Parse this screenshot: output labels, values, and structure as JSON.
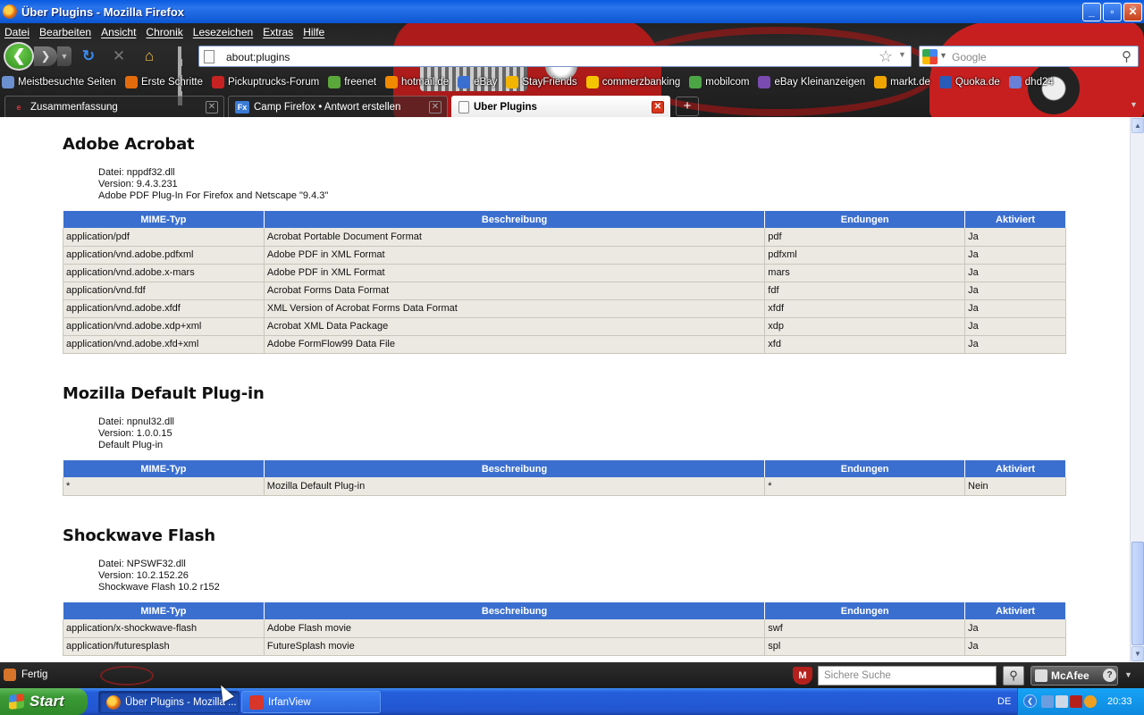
{
  "window": {
    "title": "Über Plugins - Mozilla Firefox",
    "controls": {
      "minimize": "_",
      "maximize": "▫",
      "close": "✕"
    }
  },
  "menu": [
    "Datei",
    "Bearbeiten",
    "Ansicht",
    "Chronik",
    "Lesezeichen",
    "Extras",
    "Hilfe"
  ],
  "navbar": {
    "url": "about:plugins",
    "search_placeholder": "Google",
    "icons": [
      "back-arrow-icon",
      "forward-arrow-icon",
      "reload-icon",
      "stop-icon",
      "home-icon",
      "sidebar-bars-icon",
      "star-icon",
      "magnifier-icon"
    ]
  },
  "bookmarks": [
    {
      "label": "Meistbesuchte Seiten",
      "icon": "folder-icon",
      "color": "#6c8fd0"
    },
    {
      "label": "Erste Schritte",
      "icon": "firefox-icon",
      "color": "#e46b0c"
    },
    {
      "label": "Pickuptrucks-Forum",
      "icon": "truck-icon",
      "color": "#c62222"
    },
    {
      "label": "freenet",
      "icon": "freenet-icon",
      "color": "#5aa83a"
    },
    {
      "label": "hotmail.de",
      "icon": "windows-live-icon",
      "color": "#f08a00"
    },
    {
      "label": "eBay",
      "icon": "ebay-icon",
      "color": "#3a6fd1"
    },
    {
      "label": "StayFriends",
      "icon": "crown-icon",
      "color": "#f2b400"
    },
    {
      "label": "commerzbanking",
      "icon": "commerzbank-icon",
      "color": "#f5c400"
    },
    {
      "label": "mobilcom",
      "icon": "mobilcom-icon",
      "color": "#4ca646"
    },
    {
      "label": "eBay Kleinanzeigen",
      "icon": "ebay-kleinanzeigen-icon",
      "color": "#7a4bb0"
    },
    {
      "label": "markt.de",
      "icon": "markt-icon",
      "color": "#f0a400"
    },
    {
      "label": "Quoka.de",
      "icon": "quoka-icon",
      "color": "#2a5bb8"
    },
    {
      "label": "dhd24",
      "icon": "dhd24-icon",
      "color": "#6a7fd6"
    }
  ],
  "tabs": [
    {
      "label": "Zusammenfassung",
      "favicon": "ebay-icon",
      "active": false
    },
    {
      "label": "Camp Firefox • Antwort erstellen",
      "favicon": "camp-firefox-icon",
      "active": false
    },
    {
      "label": "Über Plugins",
      "favicon": "page-icon",
      "active": true
    }
  ],
  "plugins_table_headers": [
    "MIME-Typ",
    "Beschreibung",
    "Endungen",
    "Aktiviert"
  ],
  "plugins": [
    {
      "name": "Adobe Acrobat",
      "file": "Datei: nppdf32.dll",
      "version": "Version: 9.4.3.231",
      "description": "Adobe PDF Plug-In For Firefox and Netscape \"9.4.3\"",
      "rows": [
        [
          "application/pdf",
          "Acrobat Portable Document Format",
          "pdf",
          "Ja"
        ],
        [
          "application/vnd.adobe.pdfxml",
          "Adobe PDF in XML Format",
          "pdfxml",
          "Ja"
        ],
        [
          "application/vnd.adobe.x-mars",
          "Adobe PDF in XML Format",
          "mars",
          "Ja"
        ],
        [
          "application/vnd.fdf",
          "Acrobat Forms Data Format",
          "fdf",
          "Ja"
        ],
        [
          "application/vnd.adobe.xfdf",
          "XML Version of Acrobat Forms Data Format",
          "xfdf",
          "Ja"
        ],
        [
          "application/vnd.adobe.xdp+xml",
          "Acrobat XML Data Package",
          "xdp",
          "Ja"
        ],
        [
          "application/vnd.adobe.xfd+xml",
          "Adobe FormFlow99 Data File",
          "xfd",
          "Ja"
        ]
      ]
    },
    {
      "name": "Mozilla Default Plug-in",
      "file": "Datei: npnul32.dll",
      "version": "Version: 1.0.0.15",
      "description": "Default Plug-in",
      "rows": [
        [
          "*",
          "Mozilla Default Plug-in",
          "*",
          "Nein"
        ]
      ]
    },
    {
      "name": "Shockwave Flash",
      "file": "Datei: NPSWF32.dll",
      "version": "Version: 10.2.152.26",
      "description": "Shockwave Flash 10.2 r152",
      "rows": [
        [
          "application/x-shockwave-flash",
          "Adobe Flash movie",
          "swf",
          "Ja"
        ],
        [
          "application/futuresplash",
          "FutureSplash movie",
          "spl",
          "Ja"
        ]
      ]
    }
  ],
  "statusbar": {
    "text": "Fertig",
    "secure_search_placeholder": "Sichere Suche",
    "mcafee_label": "McAfee",
    "help": "?"
  },
  "taskbar": {
    "start_label": "Start",
    "tasks": [
      {
        "label": "Über Plugins - Mozilla ...",
        "icon": "firefox-icon",
        "active": true
      },
      {
        "label": "IrfanView",
        "icon": "irfanview-icon",
        "active": false
      }
    ],
    "language": "DE",
    "clock": "20:33"
  },
  "colors": {
    "table_header": "#3b6fcf",
    "table_row": "#ebe9e1",
    "xp_titlebar": "#0a5ae0",
    "xp_taskbar": "#245edb",
    "xp_start": "#3c9b36"
  }
}
